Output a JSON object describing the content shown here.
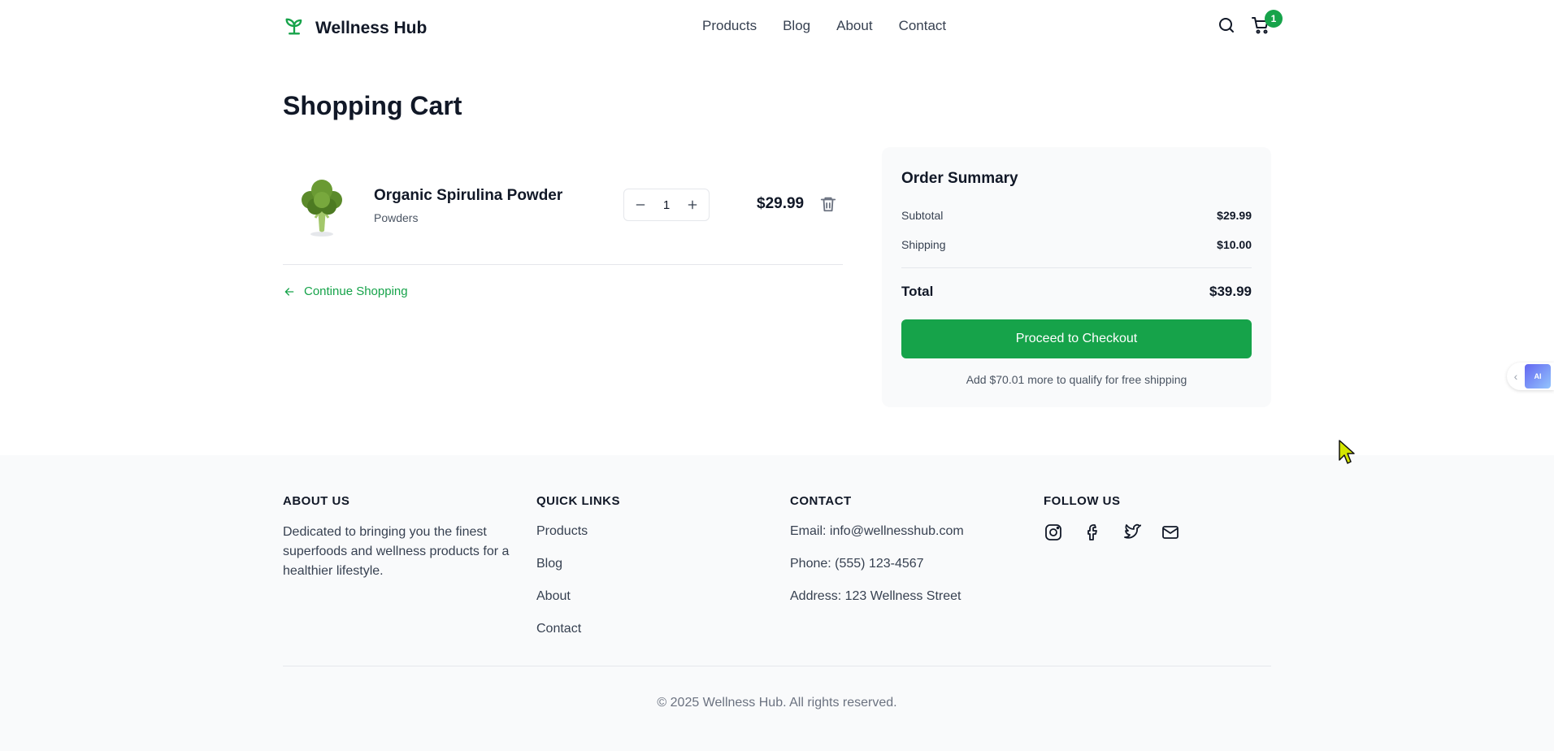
{
  "header": {
    "brand": "Wellness Hub",
    "nav": [
      "Products",
      "Blog",
      "About",
      "Contact"
    ],
    "cart_count": "1"
  },
  "page": {
    "title": "Shopping Cart"
  },
  "cart": {
    "items": [
      {
        "name": "Organic Spirulina Powder",
        "category": "Powders",
        "quantity": "1",
        "price": "$29.99"
      }
    ],
    "continue_label": "Continue Shopping"
  },
  "summary": {
    "title": "Order Summary",
    "subtotal_label": "Subtotal",
    "subtotal_value": "$29.99",
    "shipping_label": "Shipping",
    "shipping_value": "$10.00",
    "total_label": "Total",
    "total_value": "$39.99",
    "checkout_label": "Proceed to Checkout",
    "free_shipping_note": "Add $70.01 more to qualify for free shipping"
  },
  "widget": {
    "label": "AI"
  },
  "footer": {
    "about_heading": "ABOUT US",
    "about_text": "Dedicated to bringing you the finest superfoods and wellness products for a healthier lifestyle.",
    "links_heading": "QUICK LINKS",
    "links": [
      "Products",
      "Blog",
      "About",
      "Contact"
    ],
    "contact_heading": "CONTACT",
    "email": "Email: info@wellnesshub.com",
    "phone": "Phone: (555) 123-4567",
    "address": "Address: 123 Wellness Street",
    "follow_heading": "FOLLOW US",
    "socials": [
      "instagram-icon",
      "facebook-icon",
      "twitter-icon",
      "mail-icon"
    ],
    "copyright": "© 2025 Wellness Hub. All rights reserved."
  },
  "colors": {
    "accent": "#16a34a",
    "text": "#111827",
    "muted": "#374151",
    "footer_bg": "#f9fafb"
  }
}
